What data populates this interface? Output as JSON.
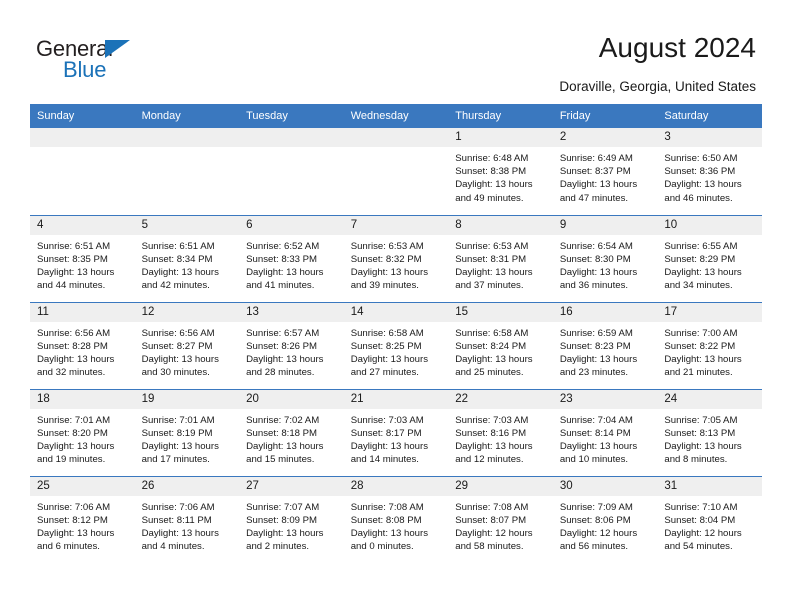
{
  "brand": {
    "name_top": "General",
    "name_bottom": "Blue",
    "accent_color": "#1b72b8"
  },
  "header": {
    "title": "August 2024",
    "subtitle": "Doraville, Georgia, United States"
  },
  "theme": {
    "header_row_bg": "#3a78bf",
    "daynum_bg": "#efefef",
    "text_color": "#1a1a1a"
  },
  "columns": [
    "Sunday",
    "Monday",
    "Tuesday",
    "Wednesday",
    "Thursday",
    "Friday",
    "Saturday"
  ],
  "weeks": [
    [
      {
        "day": "",
        "empty": true
      },
      {
        "day": "",
        "empty": true
      },
      {
        "day": "",
        "empty": true
      },
      {
        "day": "",
        "empty": true
      },
      {
        "day": "1",
        "sunrise": "Sunrise: 6:48 AM",
        "sunset": "Sunset: 8:38 PM",
        "daylight_1": "Daylight: 13 hours",
        "daylight_2": "and 49 minutes."
      },
      {
        "day": "2",
        "sunrise": "Sunrise: 6:49 AM",
        "sunset": "Sunset: 8:37 PM",
        "daylight_1": "Daylight: 13 hours",
        "daylight_2": "and 47 minutes."
      },
      {
        "day": "3",
        "sunrise": "Sunrise: 6:50 AM",
        "sunset": "Sunset: 8:36 PM",
        "daylight_1": "Daylight: 13 hours",
        "daylight_2": "and 46 minutes."
      }
    ],
    [
      {
        "day": "4",
        "sunrise": "Sunrise: 6:51 AM",
        "sunset": "Sunset: 8:35 PM",
        "daylight_1": "Daylight: 13 hours",
        "daylight_2": "and 44 minutes."
      },
      {
        "day": "5",
        "sunrise": "Sunrise: 6:51 AM",
        "sunset": "Sunset: 8:34 PM",
        "daylight_1": "Daylight: 13 hours",
        "daylight_2": "and 42 minutes."
      },
      {
        "day": "6",
        "sunrise": "Sunrise: 6:52 AM",
        "sunset": "Sunset: 8:33 PM",
        "daylight_1": "Daylight: 13 hours",
        "daylight_2": "and 41 minutes."
      },
      {
        "day": "7",
        "sunrise": "Sunrise: 6:53 AM",
        "sunset": "Sunset: 8:32 PM",
        "daylight_1": "Daylight: 13 hours",
        "daylight_2": "and 39 minutes."
      },
      {
        "day": "8",
        "sunrise": "Sunrise: 6:53 AM",
        "sunset": "Sunset: 8:31 PM",
        "daylight_1": "Daylight: 13 hours",
        "daylight_2": "and 37 minutes."
      },
      {
        "day": "9",
        "sunrise": "Sunrise: 6:54 AM",
        "sunset": "Sunset: 8:30 PM",
        "daylight_1": "Daylight: 13 hours",
        "daylight_2": "and 36 minutes."
      },
      {
        "day": "10",
        "sunrise": "Sunrise: 6:55 AM",
        "sunset": "Sunset: 8:29 PM",
        "daylight_1": "Daylight: 13 hours",
        "daylight_2": "and 34 minutes."
      }
    ],
    [
      {
        "day": "11",
        "sunrise": "Sunrise: 6:56 AM",
        "sunset": "Sunset: 8:28 PM",
        "daylight_1": "Daylight: 13 hours",
        "daylight_2": "and 32 minutes."
      },
      {
        "day": "12",
        "sunrise": "Sunrise: 6:56 AM",
        "sunset": "Sunset: 8:27 PM",
        "daylight_1": "Daylight: 13 hours",
        "daylight_2": "and 30 minutes."
      },
      {
        "day": "13",
        "sunrise": "Sunrise: 6:57 AM",
        "sunset": "Sunset: 8:26 PM",
        "daylight_1": "Daylight: 13 hours",
        "daylight_2": "and 28 minutes."
      },
      {
        "day": "14",
        "sunrise": "Sunrise: 6:58 AM",
        "sunset": "Sunset: 8:25 PM",
        "daylight_1": "Daylight: 13 hours",
        "daylight_2": "and 27 minutes."
      },
      {
        "day": "15",
        "sunrise": "Sunrise: 6:58 AM",
        "sunset": "Sunset: 8:24 PM",
        "daylight_1": "Daylight: 13 hours",
        "daylight_2": "and 25 minutes."
      },
      {
        "day": "16",
        "sunrise": "Sunrise: 6:59 AM",
        "sunset": "Sunset: 8:23 PM",
        "daylight_1": "Daylight: 13 hours",
        "daylight_2": "and 23 minutes."
      },
      {
        "day": "17",
        "sunrise": "Sunrise: 7:00 AM",
        "sunset": "Sunset: 8:22 PM",
        "daylight_1": "Daylight: 13 hours",
        "daylight_2": "and 21 minutes."
      }
    ],
    [
      {
        "day": "18",
        "sunrise": "Sunrise: 7:01 AM",
        "sunset": "Sunset: 8:20 PM",
        "daylight_1": "Daylight: 13 hours",
        "daylight_2": "and 19 minutes."
      },
      {
        "day": "19",
        "sunrise": "Sunrise: 7:01 AM",
        "sunset": "Sunset: 8:19 PM",
        "daylight_1": "Daylight: 13 hours",
        "daylight_2": "and 17 minutes."
      },
      {
        "day": "20",
        "sunrise": "Sunrise: 7:02 AM",
        "sunset": "Sunset: 8:18 PM",
        "daylight_1": "Daylight: 13 hours",
        "daylight_2": "and 15 minutes."
      },
      {
        "day": "21",
        "sunrise": "Sunrise: 7:03 AM",
        "sunset": "Sunset: 8:17 PM",
        "daylight_1": "Daylight: 13 hours",
        "daylight_2": "and 14 minutes."
      },
      {
        "day": "22",
        "sunrise": "Sunrise: 7:03 AM",
        "sunset": "Sunset: 8:16 PM",
        "daylight_1": "Daylight: 13 hours",
        "daylight_2": "and 12 minutes."
      },
      {
        "day": "23",
        "sunrise": "Sunrise: 7:04 AM",
        "sunset": "Sunset: 8:14 PM",
        "daylight_1": "Daylight: 13 hours",
        "daylight_2": "and 10 minutes."
      },
      {
        "day": "24",
        "sunrise": "Sunrise: 7:05 AM",
        "sunset": "Sunset: 8:13 PM",
        "daylight_1": "Daylight: 13 hours",
        "daylight_2": "and 8 minutes."
      }
    ],
    [
      {
        "day": "25",
        "sunrise": "Sunrise: 7:06 AM",
        "sunset": "Sunset: 8:12 PM",
        "daylight_1": "Daylight: 13 hours",
        "daylight_2": "and 6 minutes."
      },
      {
        "day": "26",
        "sunrise": "Sunrise: 7:06 AM",
        "sunset": "Sunset: 8:11 PM",
        "daylight_1": "Daylight: 13 hours",
        "daylight_2": "and 4 minutes."
      },
      {
        "day": "27",
        "sunrise": "Sunrise: 7:07 AM",
        "sunset": "Sunset: 8:09 PM",
        "daylight_1": "Daylight: 13 hours",
        "daylight_2": "and 2 minutes."
      },
      {
        "day": "28",
        "sunrise": "Sunrise: 7:08 AM",
        "sunset": "Sunset: 8:08 PM",
        "daylight_1": "Daylight: 13 hours",
        "daylight_2": "and 0 minutes."
      },
      {
        "day": "29",
        "sunrise": "Sunrise: 7:08 AM",
        "sunset": "Sunset: 8:07 PM",
        "daylight_1": "Daylight: 12 hours",
        "daylight_2": "and 58 minutes."
      },
      {
        "day": "30",
        "sunrise": "Sunrise: 7:09 AM",
        "sunset": "Sunset: 8:06 PM",
        "daylight_1": "Daylight: 12 hours",
        "daylight_2": "and 56 minutes."
      },
      {
        "day": "31",
        "sunrise": "Sunrise: 7:10 AM",
        "sunset": "Sunset: 8:04 PM",
        "daylight_1": "Daylight: 12 hours",
        "daylight_2": "and 54 minutes."
      }
    ]
  ]
}
